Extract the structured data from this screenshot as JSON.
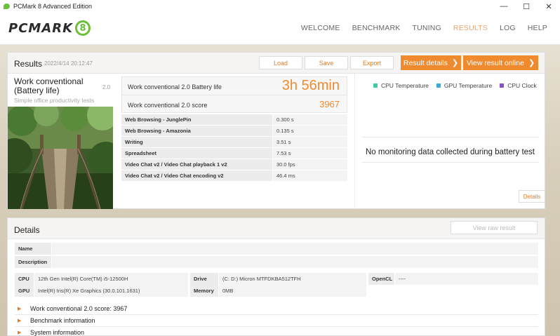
{
  "window": {
    "title": "PCMark 8 Advanced Edition",
    "minimize": "—",
    "maximize": "☐",
    "close": "✕"
  },
  "logo": {
    "text": "PCMARK",
    "badge": "8"
  },
  "nav": [
    {
      "label": "WELCOME"
    },
    {
      "label": "BENCHMARK"
    },
    {
      "label": "TUNING"
    },
    {
      "label": "RESULTS"
    },
    {
      "label": "LOG"
    },
    {
      "label": "HELP"
    }
  ],
  "results": {
    "title": "Results",
    "date": "2022/4/14 20:12:47",
    "buttons": {
      "load": "Load",
      "save": "Save",
      "export": "Export",
      "result_details": "Result details",
      "view_online": "View result online"
    }
  },
  "test": {
    "name": "Work conventional (Battery life)",
    "version": "2.0",
    "description": "Simple office productivity tests"
  },
  "scores": {
    "battery_label": "Work conventional 2.0 Battery life",
    "battery_value": "3h 56min",
    "score_label": "Work conventional 2.0 score",
    "score_value": "3967"
  },
  "metrics": [
    {
      "name": "Web Browsing - JunglePin",
      "value": "0.300 s"
    },
    {
      "name": "Web Browsing - Amazonia",
      "value": "0.135 s"
    },
    {
      "name": "Writing",
      "value": "3.51 s"
    },
    {
      "name": "Spreadsheet",
      "value": "7.53 s"
    },
    {
      "name": "Video Chat v2 / Video Chat playback 1 v2",
      "value": "30.0 fps"
    },
    {
      "name": "Video Chat v2 / Video Chat encoding v2",
      "value": "46.4 ms"
    }
  ],
  "monitoring": {
    "legend": [
      {
        "label": "CPU Temperature",
        "color": "#3fc9a6"
      },
      {
        "label": "GPU Temperature",
        "color": "#3aa9e0"
      },
      {
        "label": "CPU Clock",
        "color": "#8a4fc9"
      }
    ],
    "no_data": "No monitoring data collected during battery test",
    "details_button": "Details"
  },
  "details": {
    "title": "Details",
    "raw_button": "View raw result",
    "name_label": "Name",
    "name_value": "",
    "description_label": "Description",
    "description_value": "",
    "cpu_label": "CPU",
    "cpu_value": "12th Gen Intel(R) Core(TM) i5-12500H",
    "gpu_label": "GPU",
    "gpu_value": "Intel(R) Iris(R) Xe Graphics (30.0.101.1631)",
    "drive_label": "Drive",
    "drive_value": "(C: D:) Micron MTFDKBA512TFH",
    "memory_label": "Memory",
    "memory_value": "0MB",
    "opencl_label": "OpenCL",
    "opencl_value": "----",
    "sections": [
      {
        "label": "Work conventional 2.0 score: 3967"
      },
      {
        "label": "Benchmark information"
      },
      {
        "label": "System information"
      }
    ]
  }
}
